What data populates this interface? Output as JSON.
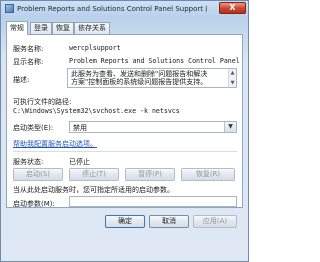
{
  "window": {
    "title": "Problem Reports and Solutions Control Panel Support 的属...",
    "close_label": "X"
  },
  "tabs": [
    {
      "label": "常规",
      "active": true
    },
    {
      "label": "登录"
    },
    {
      "label": "恢复"
    },
    {
      "label": "依存关系"
    }
  ],
  "general": {
    "service_name_label": "服务名称:",
    "service_name": "wercplsupport",
    "display_name_label": "显示名称:",
    "display_name": "Problem Reports and Solutions Control Panel S",
    "description_label": "描述:",
    "description_line1": "此服务为查看、发送和删除\"问题报告和解决",
    "description_line2": "方案\"控制面板的系统级问题报告提供支持。",
    "path_label": "可执行文件的路径:",
    "path": "C:\\Windows\\System32\\svchost.exe -k netsvcs",
    "startup_type_label": "启动类型(E):",
    "startup_type": "禁用",
    "help_link": "帮助我配置服务启动选项。",
    "status_label": "服务状态:",
    "status": "已停止",
    "start_button": "启动(S)",
    "stop_button": "停止(T)",
    "pause_button": "暂停(P)",
    "resume_button": "恢复(R)",
    "start_hint": "当从此处启动服务时，您可指定所适用的启动参数。",
    "params_label": "启动参数(M):",
    "params_value": ""
  },
  "footer": {
    "ok_button": "确定",
    "cancel_button": "取消",
    "apply_button": "应用(A)"
  }
}
